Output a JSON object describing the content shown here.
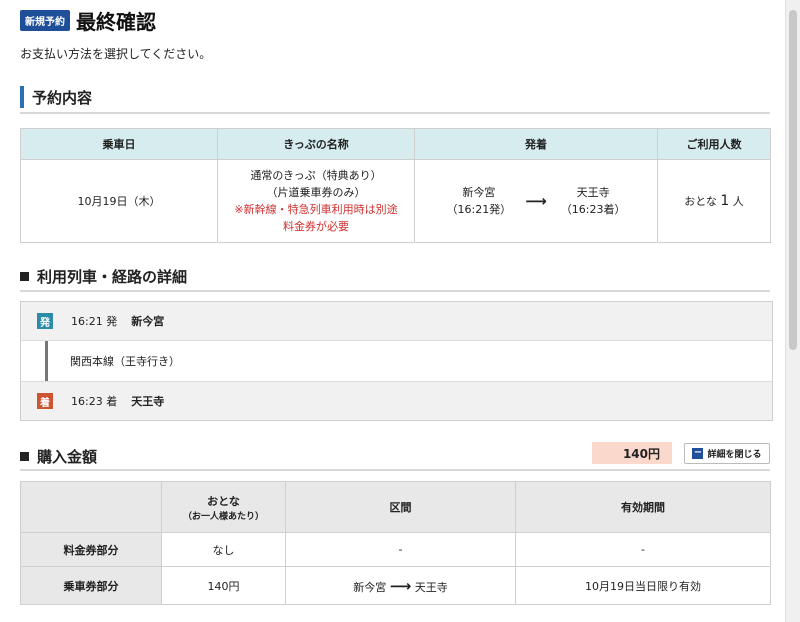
{
  "header": {
    "badge": "新規予約",
    "title": "最終確認"
  },
  "instruction": "お支払い方法を選択してください。",
  "reservation": {
    "section_title": "予約内容",
    "headers": [
      "乗車日",
      "きっぷの名称",
      "発着",
      "ご利用人数"
    ],
    "date": "10月19日（木）",
    "ticket_line1": "通常のきっぷ（特典あり）",
    "ticket_line2": "（片道乗車券のみ）",
    "ticket_note1": "※新幹線・特急列車利用時は別途",
    "ticket_note2": "料金券が必要",
    "from_station": "新今宮",
    "from_time": "（16:21発）",
    "to_station": "天王寺",
    "to_time": "（16:23着）",
    "arrow": "⟶",
    "people_prefix": "おとな",
    "people_count": "1",
    "people_unit": "人"
  },
  "route_detail": {
    "section_title": "利用列車・経路の詳細",
    "departure": {
      "tag": "発",
      "time": "16:21 発",
      "station": "新今宮"
    },
    "line": "関西本線（王寺行き）",
    "arrival": {
      "tag": "着",
      "time": "16:23 着",
      "station": "天王寺"
    }
  },
  "purchase": {
    "section_title": "購入金額",
    "total": "140円",
    "close_button": "詳細を閉じる",
    "close_icon": "minus-icon",
    "headers": {
      "blank": "",
      "adult": "おとな",
      "adult_sub": "（お一人様あたり）",
      "section": "区間",
      "validity": "有効期間"
    },
    "rows": [
      {
        "label": "料金券部分",
        "price": "なし",
        "section": "-",
        "validity": "-"
      },
      {
        "label": "乗車券部分",
        "price": "140円",
        "from": "新今宮",
        "arrow": "⟶",
        "to": "天王寺",
        "validity": "10月19日当日限り有効"
      }
    ]
  },
  "colors": {
    "badge": "#1f4f99",
    "accent_bar": "#2a6fb6",
    "table_header": "#d6ecef",
    "note_red": "#d03030",
    "price_bg": "#fbd8cc",
    "dep_tag": "#2c8ca8",
    "arr_tag": "#cc5533"
  }
}
